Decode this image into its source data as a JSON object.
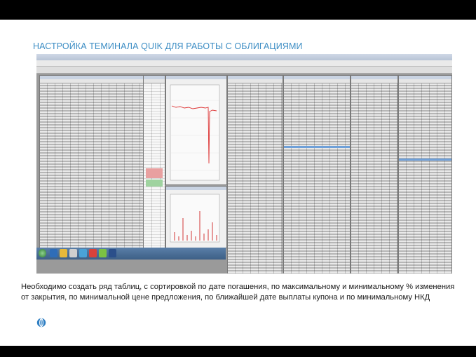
{
  "slide": {
    "title": "НАСТРОЙКА ТЕМИНАЛА QUIK ДЛЯ РАБОТЫ С ОБЛИГАЦИЯМИ",
    "caption": "Необходимо создать ряд таблиц, с сортировкой по дате погашения, по максимальному и минимальному % изменения от закрытия, по минимальной цене предложения, по ближайшей дате выплаты купона и по минимальному НКД",
    "logo_icon": "globe-logo-icon"
  },
  "screenshot": {
    "description_icon": "quik-terminal-screenshot",
    "accent": "#3c8dc4"
  }
}
